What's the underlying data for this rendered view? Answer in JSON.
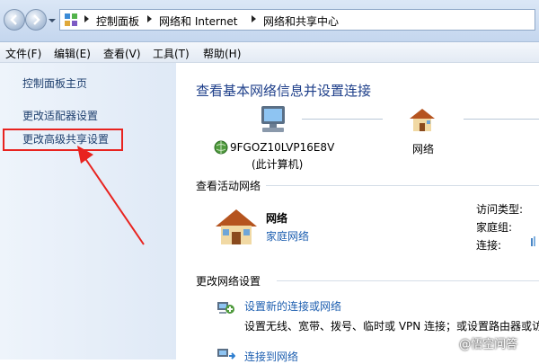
{
  "breadcrumb": [
    "控制面板",
    "网络和 Internet",
    "网络和共享中心"
  ],
  "menu": [
    "文件(F)",
    "编辑(E)",
    "查看(V)",
    "工具(T)",
    "帮助(H)"
  ],
  "left_pane": {
    "home": "控制面板主页",
    "adapter_settings": "更改适配器设置",
    "advanced_sharing": "更改高级共享设置"
  },
  "main": {
    "title": "查看基本网络信息并设置连接",
    "computer_name": "9FGOZ10LVP16E8V",
    "computer_sub": "(此计算机)",
    "network_label": "网络",
    "active_section": "查看活动网络",
    "active_network": {
      "name": "网络",
      "type": "家庭网络",
      "access_type_label": "访问类型:",
      "homegroup_label": "家庭组:",
      "connection_label": "连接:"
    },
    "change_section": "更改网络设置",
    "setup_link": "设置新的连接或网络",
    "setup_desc": "设置无线、宽带、拨号、临时或 VPN 连接；或设置路由器或访",
    "connect_link": "连接到网络"
  },
  "watermark": "@悟空问答",
  "colors": {
    "highlight": "#e8231f",
    "link": "#1e5fb0",
    "title": "#1e3f8a"
  }
}
